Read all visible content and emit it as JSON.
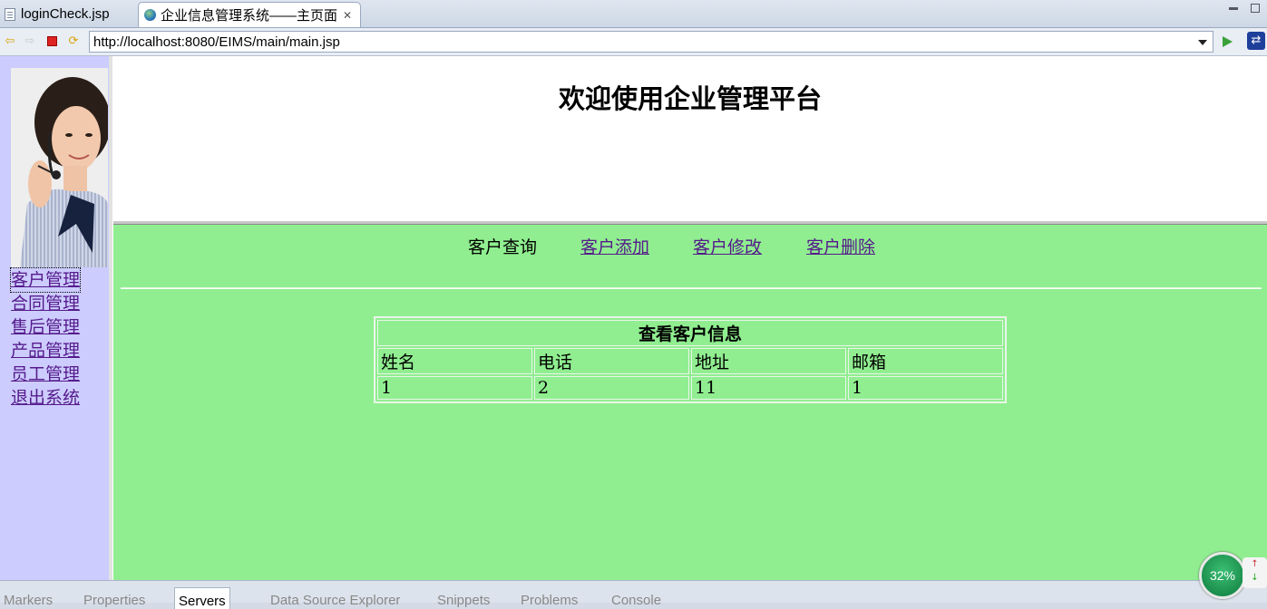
{
  "tabs": [
    {
      "label": "loginCheck.jsp"
    },
    {
      "label": "企业信息管理系统——主页面"
    }
  ],
  "address": {
    "url": "http://localhost:8080/EIMS/main/main.jsp"
  },
  "sidebar": {
    "items": [
      {
        "label": "客户管理"
      },
      {
        "label": "合同管理"
      },
      {
        "label": "售后管理"
      },
      {
        "label": "产品管理"
      },
      {
        "label": "员工管理"
      },
      {
        "label": "退出系统"
      }
    ]
  },
  "header": {
    "title": "欢迎使用企业管理平台"
  },
  "subnav": {
    "query": "客户查询",
    "add": "客户添加",
    "edit": "客户修改",
    "delete": "客户删除"
  },
  "table": {
    "caption": "查看客户信息",
    "columns": [
      "姓名",
      "电话",
      "地址",
      "邮箱"
    ],
    "rows": [
      [
        "1",
        "2",
        "11",
        "1"
      ]
    ]
  },
  "status": {
    "views": [
      "Markers",
      "Properties",
      "Servers",
      "Data Source Explorer",
      "Snippets",
      "Problems",
      "Console"
    ],
    "gauge": "32%"
  },
  "colors": {
    "sidebar_bg": "#ccccff",
    "main_bg": "#90ee90",
    "link": "#551a8b"
  }
}
